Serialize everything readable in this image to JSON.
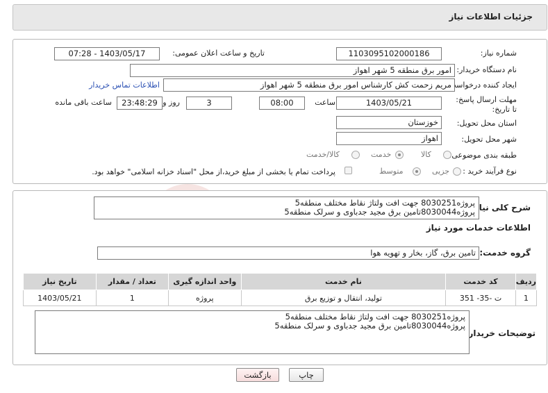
{
  "header": {
    "title": "جزئیات اطلاعات نیاز"
  },
  "fields": {
    "need_number_label": "شماره نیاز:",
    "need_number": "1103095102000186",
    "announce_label": "تاریخ و ساعت اعلان عمومی:",
    "announce_value": "1403/05/17 - 07:28",
    "buyer_org_label": "نام دستگاه خریدار:",
    "buyer_org": "امور برق منطقه 5 شهر اهواز",
    "creator_label": "ایجاد کننده درخواست:",
    "creator": "مریم زحمت کش کارشناس امور برق منطقه 5 شهر اهواز",
    "contact_link": "اطلاعات تماس خریدار",
    "deadline_label": "مهلت ارسال پاسخ: تا تاریخ:",
    "deadline_date": "1403/05/21",
    "time_label": "ساعت",
    "deadline_time": "08:00",
    "days_value": "3",
    "days_label": "روز و",
    "remaining_time": "23:48:29",
    "remaining_label": "ساعت باقی مانده",
    "province_label": "استان محل تحویل:",
    "province": "خوزستان",
    "city_label": "شهر محل تحویل:",
    "city": "اهواز",
    "category_label": "طبقه بندی موضوعی:",
    "category_options": [
      "کالا",
      "خدمت",
      "کالا/خدمت"
    ],
    "category_selected": "خدمت",
    "process_label": "نوع فرآیند خرید :",
    "process_options": [
      "جزیی",
      "متوسط"
    ],
    "process_selected": "متوسط",
    "payment_note": "پرداخت تمام یا بخشی از مبلغ خرید،از محل \"اسناد خزانه اسلامی\" خواهد بود."
  },
  "summary": {
    "label": "شرح کلی نیاز:",
    "line1": "پروژه8030251 جهت افت ولتاژ نقاط مختلف منطقه5",
    "line2": "پروژه8030044تامین برق مجید جدباوی و سرلک منطقه5"
  },
  "services": {
    "section_title": "اطلاعات خدمات مورد نیاز",
    "group_label": "گروه خدمت:",
    "group_value": "تامین برق، گاز، بخار و تهویه هوا",
    "table": {
      "headers": [
        "ردیف",
        "کد خدمت",
        "نام خدمت",
        "واحد اندازه گیری",
        "تعداد / مقدار",
        "تاریخ نیاز"
      ],
      "rows": [
        [
          "1",
          "ت -35- 351",
          "تولید، انتقال و توزیع برق",
          "پروژه",
          "1",
          "1403/05/21"
        ]
      ]
    }
  },
  "buyer_notes": {
    "label": "توضیحات خریدار:",
    "line1": "پروژه8030251 جهت افت ولتاژ نقاط مختلف منطقه5",
    "line2": "پروژه8030044تامین برق مجید جدباوی و سرلک منطقه5"
  },
  "buttons": {
    "print": "چاپ",
    "back": "بازگشت"
  },
  "watermark": {
    "text": "AriaTender.neT"
  },
  "colors": {
    "link": "#2a4fb3",
    "header_bg": "#e8e8e8",
    "table_header_bg": "#d6d6d6",
    "watermark": "#c0392b"
  }
}
